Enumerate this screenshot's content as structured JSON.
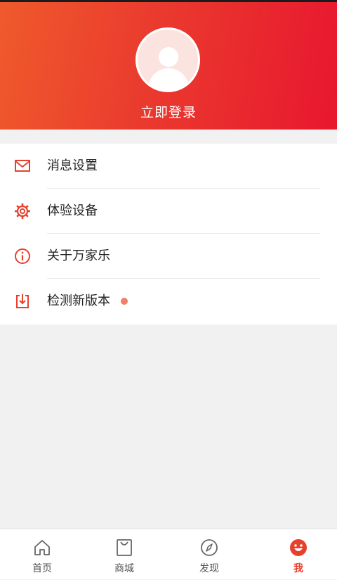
{
  "profile": {
    "login_label": "立即登录"
  },
  "menu": {
    "items": [
      {
        "label": "消息设置",
        "icon": "mail-icon"
      },
      {
        "label": "体验设备",
        "icon": "gear-icon"
      },
      {
        "label": "关于万家乐",
        "icon": "info-icon"
      },
      {
        "label": "检测新版本",
        "icon": "download-icon",
        "badge": "red-dot"
      }
    ]
  },
  "tabbar": {
    "tabs": [
      {
        "label": "首页",
        "icon": "home-icon"
      },
      {
        "label": "商城",
        "icon": "shopping-bag-icon"
      },
      {
        "label": "发现",
        "icon": "compass-icon"
      },
      {
        "label": "我",
        "icon": "smile-face-icon",
        "active": true
      }
    ]
  },
  "colors": {
    "accent": "#e8402c",
    "header_start": "#ef5a2c",
    "header_end": "#e8172f",
    "badge": "#f07f6c"
  }
}
